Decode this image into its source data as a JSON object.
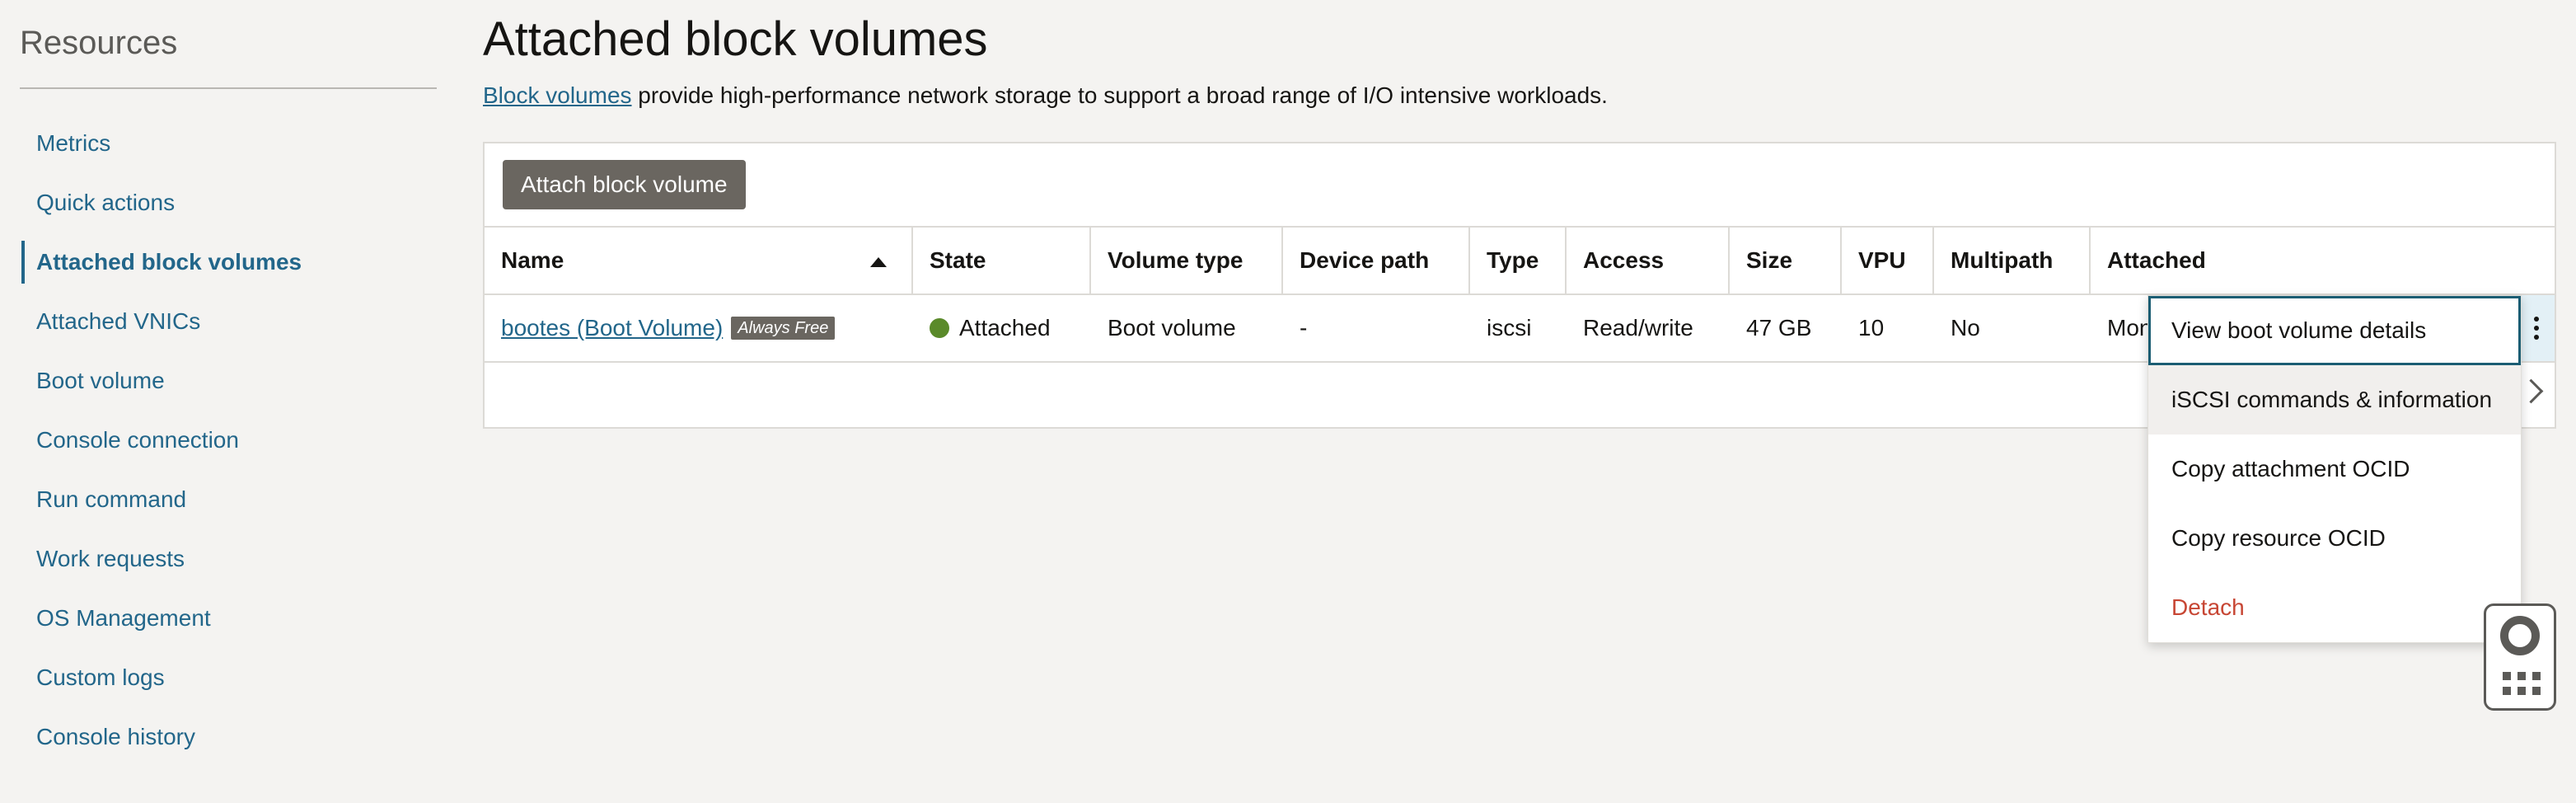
{
  "sidebar": {
    "title": "Resources",
    "items": [
      {
        "label": "Metrics"
      },
      {
        "label": "Quick actions"
      },
      {
        "label": "Attached block volumes"
      },
      {
        "label": "Attached VNICs"
      },
      {
        "label": "Boot volume"
      },
      {
        "label": "Console connection"
      },
      {
        "label": "Run command"
      },
      {
        "label": "Work requests"
      },
      {
        "label": "OS Management"
      },
      {
        "label": "Custom logs"
      },
      {
        "label": "Console history"
      }
    ],
    "active_index": 2
  },
  "main": {
    "title": "Attached block volumes",
    "description_link": "Block volumes",
    "description_rest": " provide high-performance network storage to support a broad range of I/O intensive workloads.",
    "attach_button": "Attach block volume"
  },
  "table": {
    "columns": [
      "Name",
      "State",
      "Volume type",
      "Device path",
      "Type",
      "Access",
      "Size",
      "VPU",
      "Multipath",
      "Attached"
    ],
    "sort_column": "Name",
    "sort_direction": "ascending",
    "rows": [
      {
        "name": "bootes (Boot Volume)",
        "badge": "Always Free",
        "state": "Attached",
        "state_color": "#5a8a2a",
        "volume_type": "Boot volume",
        "device_path": "-",
        "type": "iscsi",
        "access": "Read/write",
        "size": "47 GB",
        "vpu": "10",
        "multipath": "No",
        "attached": "Mon"
      }
    ]
  },
  "row_menu": {
    "items": [
      {
        "label": "View boot volume details",
        "state": "focused"
      },
      {
        "label": "iSCSI commands & information",
        "state": "hover"
      },
      {
        "label": "Copy attachment OCID",
        "state": "normal"
      },
      {
        "label": "Copy resource OCID",
        "state": "normal"
      },
      {
        "label": "Detach",
        "state": "danger"
      }
    ]
  },
  "colors": {
    "link": "#22668a",
    "danger": "#c74634",
    "button_bg": "#6a6660",
    "status_attached": "#5a8a2a"
  },
  "icons": [
    "sort-ascending-icon",
    "status-dot-icon",
    "kebab-menu-icon",
    "chevron-right-icon",
    "lifebuoy-icon",
    "apps-grid-icon"
  ]
}
